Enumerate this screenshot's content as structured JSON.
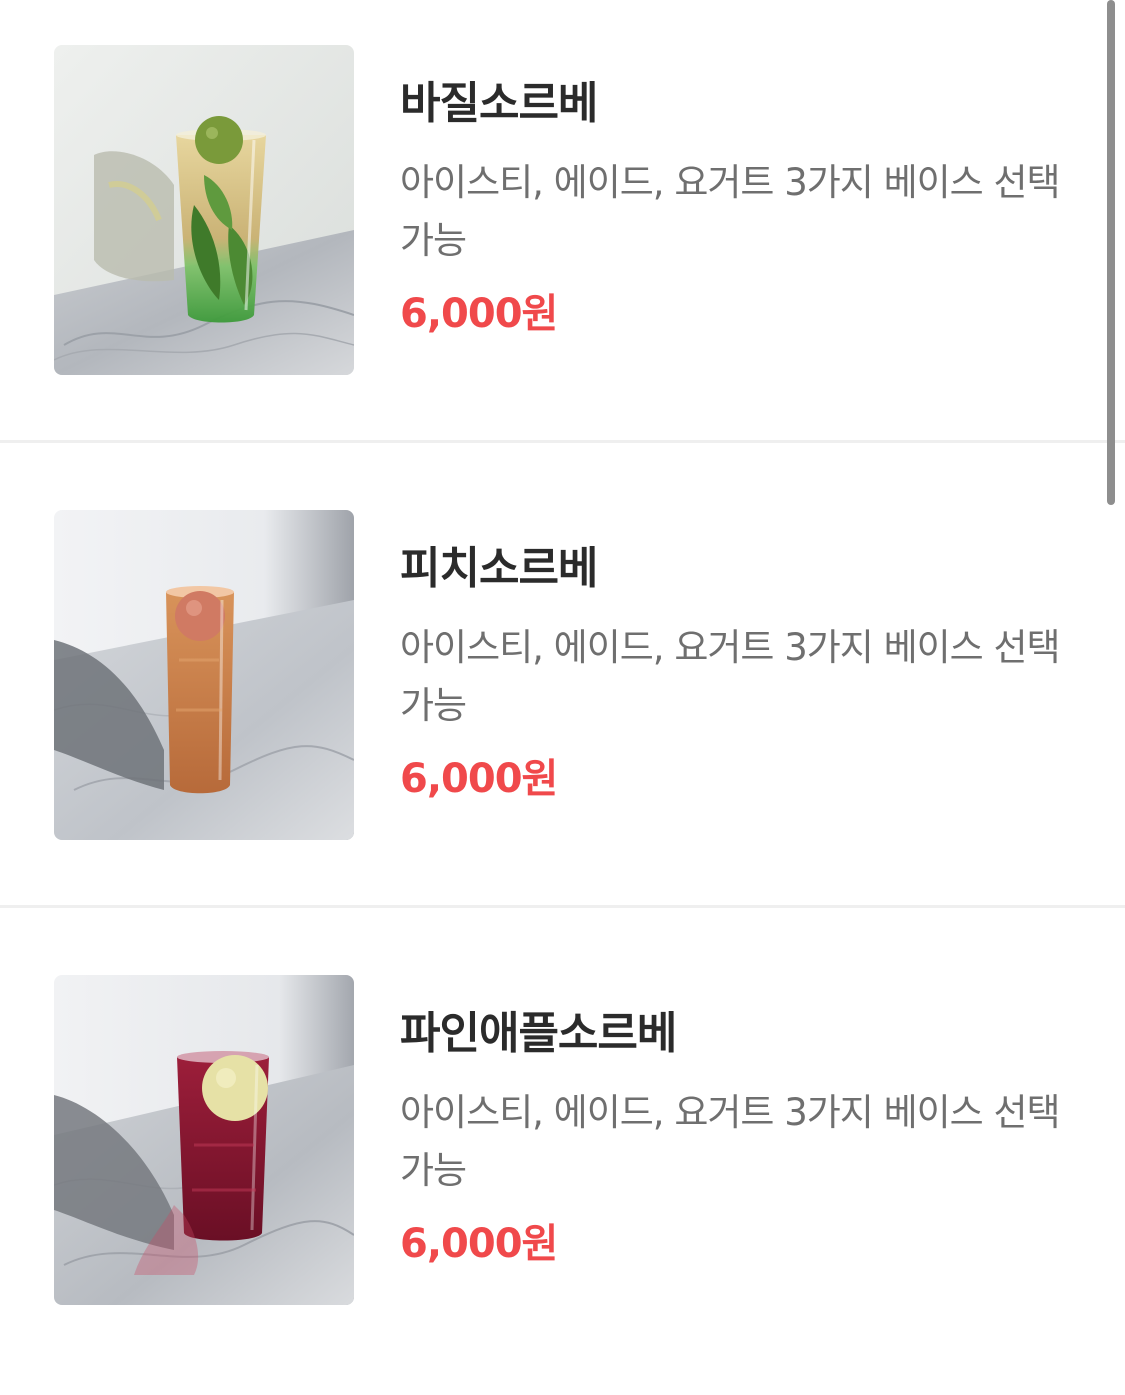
{
  "menu": {
    "items": [
      {
        "name": "바질소르베",
        "description": "아이스티, 에이드, 요거트 3가지 베이스 선택가능",
        "price": "6,000원",
        "image_icon": "basil-sorbet-drink-photo"
      },
      {
        "name": "피치소르베",
        "description": "아이스티, 에이드, 요거트 3가지 베이스 선택가능",
        "price": "6,000원",
        "image_icon": "peach-sorbet-drink-photo"
      },
      {
        "name": "파인애플소르베",
        "description": "아이스티, 에이드, 요거트 3가지 베이스 선택가능",
        "price": "6,000원",
        "image_icon": "pineapple-sorbet-drink-photo"
      }
    ]
  },
  "colors": {
    "title": "#2b2b2b",
    "description": "#6f6f6f",
    "price": "#f0494b",
    "divider": "#efefef"
  }
}
